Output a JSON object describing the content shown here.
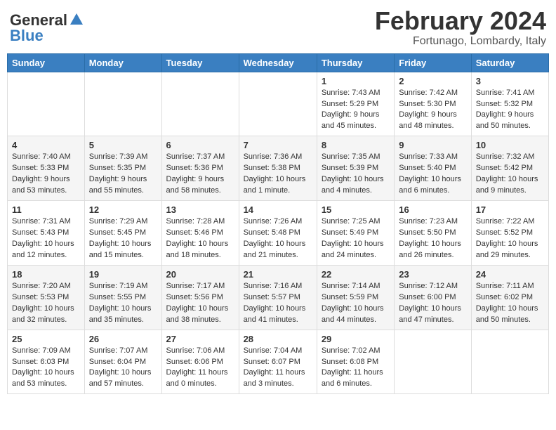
{
  "logo": {
    "general": "General",
    "blue": "Blue",
    "tagline": "GeneralBlue"
  },
  "header": {
    "month": "February 2024",
    "location": "Fortunago, Lombardy, Italy"
  },
  "weekdays": [
    "Sunday",
    "Monday",
    "Tuesday",
    "Wednesday",
    "Thursday",
    "Friday",
    "Saturday"
  ],
  "weeks": [
    [
      {
        "day": "",
        "sunrise": "",
        "sunset": "",
        "daylight": ""
      },
      {
        "day": "",
        "sunrise": "",
        "sunset": "",
        "daylight": ""
      },
      {
        "day": "",
        "sunrise": "",
        "sunset": "",
        "daylight": ""
      },
      {
        "day": "",
        "sunrise": "",
        "sunset": "",
        "daylight": ""
      },
      {
        "day": "1",
        "sunrise": "Sunrise: 7:43 AM",
        "sunset": "Sunset: 5:29 PM",
        "daylight": "Daylight: 9 hours and 45 minutes."
      },
      {
        "day": "2",
        "sunrise": "Sunrise: 7:42 AM",
        "sunset": "Sunset: 5:30 PM",
        "daylight": "Daylight: 9 hours and 48 minutes."
      },
      {
        "day": "3",
        "sunrise": "Sunrise: 7:41 AM",
        "sunset": "Sunset: 5:32 PM",
        "daylight": "Daylight: 9 hours and 50 minutes."
      }
    ],
    [
      {
        "day": "4",
        "sunrise": "Sunrise: 7:40 AM",
        "sunset": "Sunset: 5:33 PM",
        "daylight": "Daylight: 9 hours and 53 minutes."
      },
      {
        "day": "5",
        "sunrise": "Sunrise: 7:39 AM",
        "sunset": "Sunset: 5:35 PM",
        "daylight": "Daylight: 9 hours and 55 minutes."
      },
      {
        "day": "6",
        "sunrise": "Sunrise: 7:37 AM",
        "sunset": "Sunset: 5:36 PM",
        "daylight": "Daylight: 9 hours and 58 minutes."
      },
      {
        "day": "7",
        "sunrise": "Sunrise: 7:36 AM",
        "sunset": "Sunset: 5:38 PM",
        "daylight": "Daylight: 10 hours and 1 minute."
      },
      {
        "day": "8",
        "sunrise": "Sunrise: 7:35 AM",
        "sunset": "Sunset: 5:39 PM",
        "daylight": "Daylight: 10 hours and 4 minutes."
      },
      {
        "day": "9",
        "sunrise": "Sunrise: 7:33 AM",
        "sunset": "Sunset: 5:40 PM",
        "daylight": "Daylight: 10 hours and 6 minutes."
      },
      {
        "day": "10",
        "sunrise": "Sunrise: 7:32 AM",
        "sunset": "Sunset: 5:42 PM",
        "daylight": "Daylight: 10 hours and 9 minutes."
      }
    ],
    [
      {
        "day": "11",
        "sunrise": "Sunrise: 7:31 AM",
        "sunset": "Sunset: 5:43 PM",
        "daylight": "Daylight: 10 hours and 12 minutes."
      },
      {
        "day": "12",
        "sunrise": "Sunrise: 7:29 AM",
        "sunset": "Sunset: 5:45 PM",
        "daylight": "Daylight: 10 hours and 15 minutes."
      },
      {
        "day": "13",
        "sunrise": "Sunrise: 7:28 AM",
        "sunset": "Sunset: 5:46 PM",
        "daylight": "Daylight: 10 hours and 18 minutes."
      },
      {
        "day": "14",
        "sunrise": "Sunrise: 7:26 AM",
        "sunset": "Sunset: 5:48 PM",
        "daylight": "Daylight: 10 hours and 21 minutes."
      },
      {
        "day": "15",
        "sunrise": "Sunrise: 7:25 AM",
        "sunset": "Sunset: 5:49 PM",
        "daylight": "Daylight: 10 hours and 24 minutes."
      },
      {
        "day": "16",
        "sunrise": "Sunrise: 7:23 AM",
        "sunset": "Sunset: 5:50 PM",
        "daylight": "Daylight: 10 hours and 26 minutes."
      },
      {
        "day": "17",
        "sunrise": "Sunrise: 7:22 AM",
        "sunset": "Sunset: 5:52 PM",
        "daylight": "Daylight: 10 hours and 29 minutes."
      }
    ],
    [
      {
        "day": "18",
        "sunrise": "Sunrise: 7:20 AM",
        "sunset": "Sunset: 5:53 PM",
        "daylight": "Daylight: 10 hours and 32 minutes."
      },
      {
        "day": "19",
        "sunrise": "Sunrise: 7:19 AM",
        "sunset": "Sunset: 5:55 PM",
        "daylight": "Daylight: 10 hours and 35 minutes."
      },
      {
        "day": "20",
        "sunrise": "Sunrise: 7:17 AM",
        "sunset": "Sunset: 5:56 PM",
        "daylight": "Daylight: 10 hours and 38 minutes."
      },
      {
        "day": "21",
        "sunrise": "Sunrise: 7:16 AM",
        "sunset": "Sunset: 5:57 PM",
        "daylight": "Daylight: 10 hours and 41 minutes."
      },
      {
        "day": "22",
        "sunrise": "Sunrise: 7:14 AM",
        "sunset": "Sunset: 5:59 PM",
        "daylight": "Daylight: 10 hours and 44 minutes."
      },
      {
        "day": "23",
        "sunrise": "Sunrise: 7:12 AM",
        "sunset": "Sunset: 6:00 PM",
        "daylight": "Daylight: 10 hours and 47 minutes."
      },
      {
        "day": "24",
        "sunrise": "Sunrise: 7:11 AM",
        "sunset": "Sunset: 6:02 PM",
        "daylight": "Daylight: 10 hours and 50 minutes."
      }
    ],
    [
      {
        "day": "25",
        "sunrise": "Sunrise: 7:09 AM",
        "sunset": "Sunset: 6:03 PM",
        "daylight": "Daylight: 10 hours and 53 minutes."
      },
      {
        "day": "26",
        "sunrise": "Sunrise: 7:07 AM",
        "sunset": "Sunset: 6:04 PM",
        "daylight": "Daylight: 10 hours and 57 minutes."
      },
      {
        "day": "27",
        "sunrise": "Sunrise: 7:06 AM",
        "sunset": "Sunset: 6:06 PM",
        "daylight": "Daylight: 11 hours and 0 minutes."
      },
      {
        "day": "28",
        "sunrise": "Sunrise: 7:04 AM",
        "sunset": "Sunset: 6:07 PM",
        "daylight": "Daylight: 11 hours and 3 minutes."
      },
      {
        "day": "29",
        "sunrise": "Sunrise: 7:02 AM",
        "sunset": "Sunset: 6:08 PM",
        "daylight": "Daylight: 11 hours and 6 minutes."
      },
      {
        "day": "",
        "sunrise": "",
        "sunset": "",
        "daylight": ""
      },
      {
        "day": "",
        "sunrise": "",
        "sunset": "",
        "daylight": ""
      }
    ]
  ]
}
